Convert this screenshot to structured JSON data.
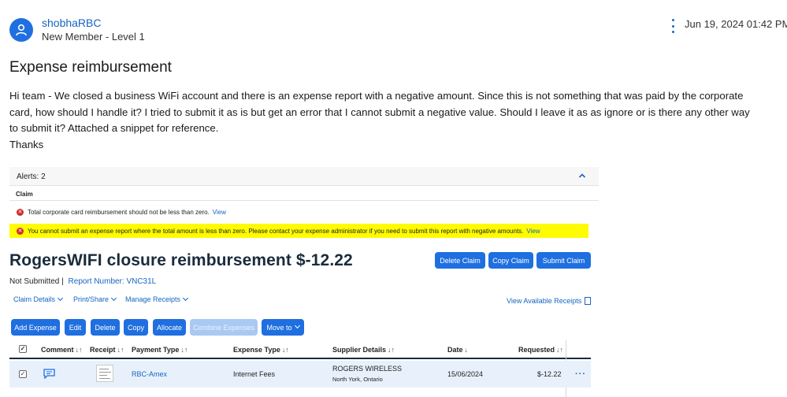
{
  "post": {
    "author": "shobhaRBC",
    "rank": "New Member - Level 1",
    "date": "Jun 19, 2024 01:42 PM",
    "title": "Expense reimbursement",
    "body": "Hi team - We closed a business WiFi account and there is an expense report with a negative amount. Since this is not something that was paid by the corporate card, how should I handle it? I tried to submit it as is but get an error that I cannot submit a negative value. Should I leave it as as ignore or is there any other way to submit it? Attached a snippet for reference.",
    "signoff": "Thanks"
  },
  "alerts": {
    "title": "Alerts: 2",
    "section": "Claim",
    "items": [
      {
        "text": "Total corporate card reimbursement should not be less than zero.",
        "link": "View",
        "highlighted": false
      },
      {
        "text": "You cannot submit an expense report where the total amount is less than zero. Please contact your expense administrator if you need to submit this report with negative amounts.",
        "link": "View",
        "highlighted": true
      }
    ]
  },
  "report": {
    "title": "RogersWIFI closure reimbursement $-12.22",
    "status": "Not Submitted |",
    "number": "Report Number: VNC31L",
    "buttons": {
      "delete": "Delete Claim",
      "copy": "Copy Claim",
      "submit": "Submit Claim"
    }
  },
  "menus": {
    "claim_details": "Claim Details",
    "print_share": "Print/Share",
    "manage_receipts": "Manage Receipts",
    "available_receipts": "View Available Receipts"
  },
  "toolbar": {
    "add_expense": "Add Expense",
    "edit": "Edit",
    "delete": "Delete",
    "copy": "Copy",
    "allocate": "Allocate",
    "combine": "Combine Expenses",
    "move_to": "Move to"
  },
  "table": {
    "headers": {
      "comment": "Comment",
      "receipt": "Receipt",
      "payment_type": "Payment Type",
      "expense_type": "Expense Type",
      "supplier": "Supplier Details",
      "date": "Date",
      "requested": "Requested"
    },
    "rows": [
      {
        "checked": true,
        "payment_type": "RBC-Amex",
        "expense_type": "Internet Fees",
        "supplier": "ROGERS WIRELESS",
        "supplier_location": "North York, Ontario",
        "date": "15/06/2024",
        "requested": "$-12.22"
      }
    ]
  },
  "colors": {
    "accent": "#1f6fe0",
    "link": "#1565c0",
    "alert_highlight": "#fffb00",
    "error": "#d12d2d",
    "row_selected": "#e8f1fb"
  }
}
